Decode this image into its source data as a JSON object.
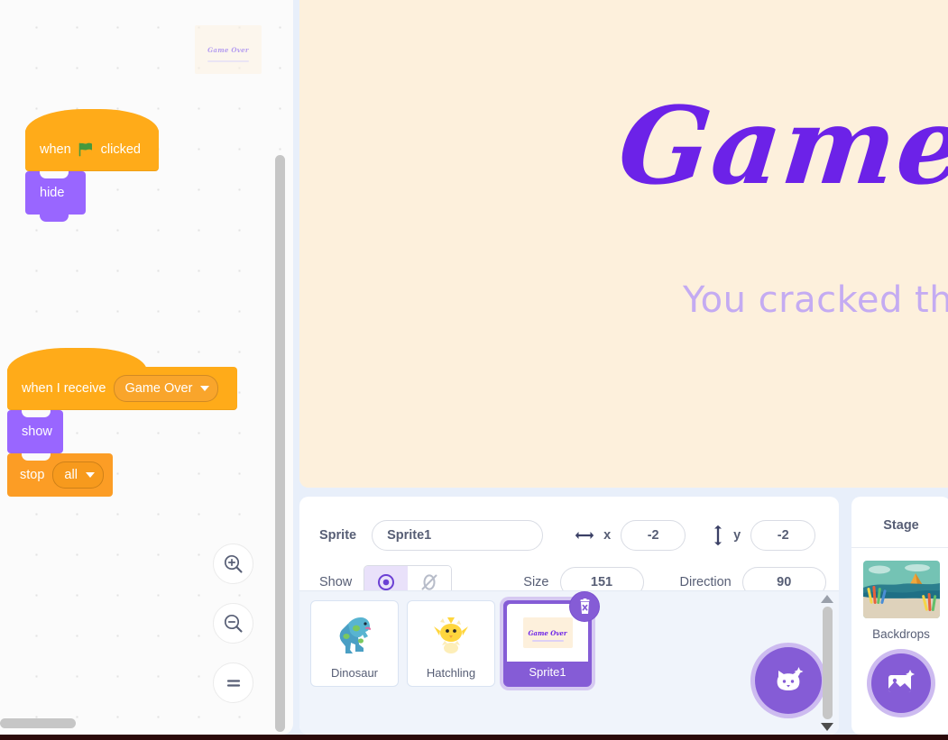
{
  "stage": {
    "title": "Game Over",
    "subtitle": "You cracked the hatchling!",
    "background_color": "#fdf0dc",
    "title_color": "#6c22e8",
    "subtitle_color": "#c4abf2"
  },
  "code_area": {
    "ghost_sprite_label": "Game Over",
    "scripts": [
      {
        "id": "script-green-flag",
        "blocks": [
          {
            "type": "hat",
            "kind": "event",
            "parts": [
              "when",
              "green-flag-icon",
              "clicked"
            ]
          },
          {
            "type": "stack",
            "kind": "looks",
            "label": "hide"
          }
        ]
      },
      {
        "id": "script-when-i-receive",
        "blocks": [
          {
            "type": "hat",
            "kind": "event",
            "label": "when I receive",
            "dropdown_value": "Game Over"
          },
          {
            "type": "stack",
            "kind": "looks",
            "label": "show"
          },
          {
            "type": "cap",
            "kind": "control",
            "label": "stop",
            "dropdown_value": "all"
          }
        ]
      }
    ],
    "block_text": {
      "when": "when",
      "clicked": "clicked",
      "hide": "hide",
      "when_i_receive": "when I receive",
      "message": "Game Over",
      "show": "show",
      "stop": "stop",
      "stop_option": "all"
    },
    "zoom_controls": [
      {
        "name": "zoom-in",
        "glyph": "+"
      },
      {
        "name": "zoom-out",
        "glyph": "−"
      },
      {
        "name": "zoom-reset",
        "glyph": "="
      }
    ],
    "colors": {
      "events": "#ffab19",
      "looks": "#9966ff",
      "control": "#fc9d25"
    }
  },
  "sprite_info": {
    "sprite_label": "Sprite",
    "sprite_name": "Sprite1",
    "x_label": "x",
    "x_value": "-2",
    "y_label": "y",
    "y_value": "-2",
    "show_label": "Show",
    "show_visible": true,
    "size_label": "Size",
    "size_value": "151",
    "direction_label": "Direction",
    "direction_value": "90"
  },
  "sprite_selector": {
    "sprites": [
      {
        "name": "Dinosaur",
        "selected": false,
        "thumb": "dinosaur"
      },
      {
        "name": "Hatchling",
        "selected": false,
        "thumb": "hatchling"
      },
      {
        "name": "Sprite1",
        "selected": true,
        "thumb": "game-over-card"
      }
    ],
    "add_sprite_tooltip": "Choose a Sprite",
    "delete_badge": "delete-sprite"
  },
  "stage_panel": {
    "title": "Stage",
    "backdrops_label": "Backdrops",
    "add_backdrop_tooltip": "Choose a Backdrop"
  }
}
